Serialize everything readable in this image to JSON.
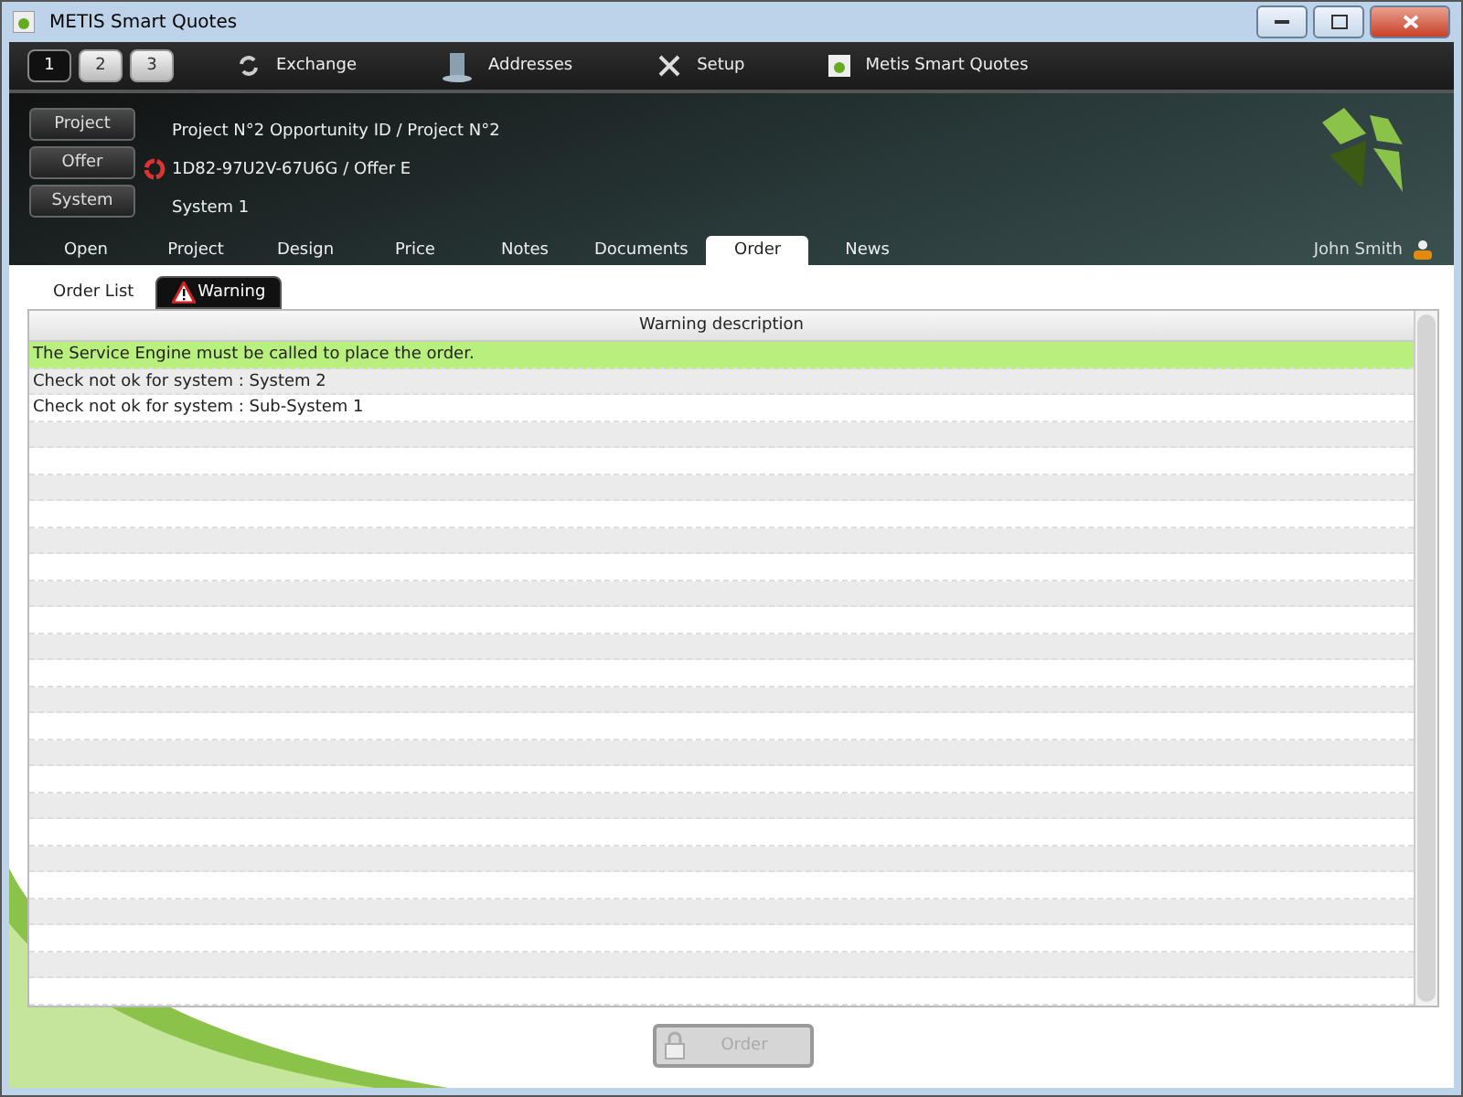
{
  "window": {
    "title": "METIS Smart Quotes"
  },
  "pages": [
    {
      "label": "1",
      "selected": true
    },
    {
      "label": "2",
      "selected": false
    },
    {
      "label": "3",
      "selected": false
    }
  ],
  "toolbar": [
    {
      "label": "Exchange",
      "kind": "exchange"
    },
    {
      "label": "Addresses",
      "kind": "addresses"
    },
    {
      "label": "Setup",
      "kind": "setup"
    },
    {
      "label": "Metis Smart Quotes",
      "kind": "app"
    }
  ],
  "context_buttons": [
    "Project",
    "Offer",
    "System"
  ],
  "context_lines": [
    {
      "text": "Project N°2 Opportunity ID / Project N°2",
      "kind": "plain"
    },
    {
      "text": "1D82-97U2V-67U6G / Offer E",
      "kind": "sync"
    },
    {
      "text": "System 1",
      "kind": "plain"
    }
  ],
  "user": "John Smith",
  "tabs": [
    {
      "label": "Open",
      "selected": false
    },
    {
      "label": "Project",
      "selected": false
    },
    {
      "label": "Design",
      "selected": false
    },
    {
      "label": "Price",
      "selected": false
    },
    {
      "label": "Notes",
      "selected": false
    },
    {
      "label": "Documents",
      "selected": false
    },
    {
      "label": "Order",
      "selected": true
    },
    {
      "label": "News",
      "selected": false
    }
  ],
  "subtabs": [
    {
      "label": "Order List",
      "selected": false,
      "kind": "plain"
    },
    {
      "label": "Warning",
      "selected": true,
      "kind": "warning"
    }
  ],
  "table": {
    "columns": [
      "Warning description"
    ],
    "rows": [
      {
        "text": "The Service Engine must be called to place the order.",
        "selected": true
      },
      {
        "text": "Check not ok for system : System 2",
        "selected": false
      },
      {
        "text": "Check not ok for system : Sub-System 1",
        "selected": false
      }
    ]
  },
  "order_button": {
    "label": "Order",
    "disabled": true
  }
}
